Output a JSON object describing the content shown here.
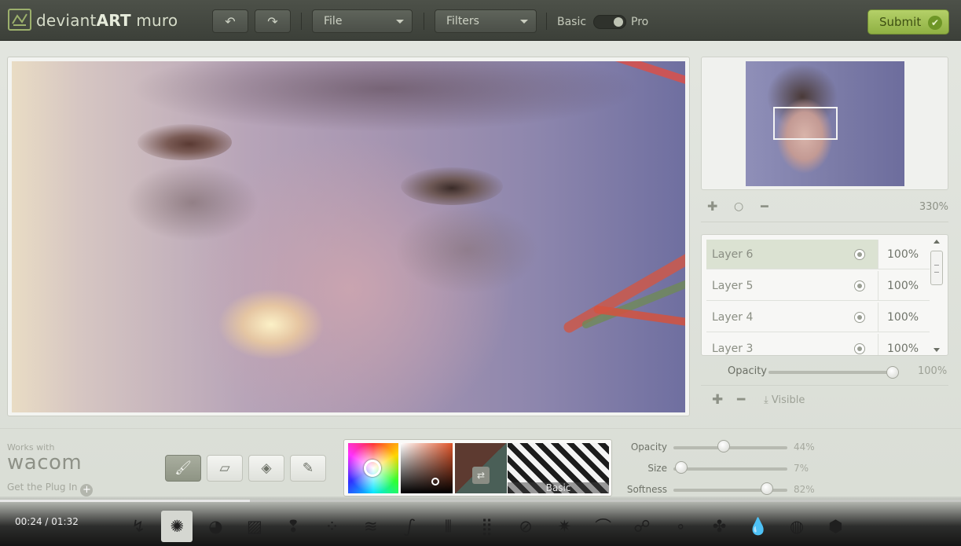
{
  "app": {
    "logo_text_light": "deviant",
    "logo_text_bold": "ART",
    "logo_text_tail": " muro"
  },
  "toolbar": {
    "undo_icon": "undo-icon",
    "redo_icon": "redo-icon",
    "file_label": "File",
    "filters_label": "Filters",
    "mode_basic": "Basic",
    "mode_pro": "Pro",
    "submit_label": "Submit"
  },
  "navigator": {
    "zoom": "330%"
  },
  "layers": {
    "items": [
      {
        "name": "Layer 6",
        "opacity": "100%"
      },
      {
        "name": "Layer 5",
        "opacity": "100%"
      },
      {
        "name": "Layer 4",
        "opacity": "100%"
      },
      {
        "name": "Layer 3",
        "opacity": "100%"
      }
    ],
    "opacity_label": "Opacity",
    "opacity_value": "100%",
    "visible_label": "Visible"
  },
  "wacom": {
    "works_with": "Works with",
    "logo": "wacom",
    "plugin_label": "Get the Plug In"
  },
  "tools": [
    "brush-icon",
    "eraser-icon",
    "fill-icon",
    "eyedropper-icon"
  ],
  "color": {
    "texture_label": "Basic",
    "foreground": "#5d3a30",
    "background": "#4a5f57"
  },
  "brush": {
    "opacity_label": "Opacity",
    "opacity_value": "44%",
    "opacity_level": 0.44,
    "size_label": "Size",
    "size_value": "7%",
    "size_level": 0.07,
    "softness_label": "Softness",
    "softness_value": "82%",
    "softness_level": 0.82
  },
  "video": {
    "timecode": "00:24 / 01:32",
    "progress": 0.26
  },
  "brushes": [
    "pencil-brush-icon",
    "airbrush-icon",
    "ink-blot-brush-icon",
    "hatch-brush-icon",
    "drip-brush-icon",
    "splatter-brush-icon",
    "squiggle-brush-icon",
    "curl-brush-icon",
    "bristle-brush-icon",
    "dots-brush-icon",
    "line-pattern-brush-icon",
    "star-burst-brush-icon",
    "stroke-brush-icon",
    "circle-pen-brush-icon",
    "bubbles-brush-icon",
    "leaf-brush-icon",
    "droplet-brush-icon",
    "sphere-brush-icon",
    "cube-brush-icon"
  ]
}
